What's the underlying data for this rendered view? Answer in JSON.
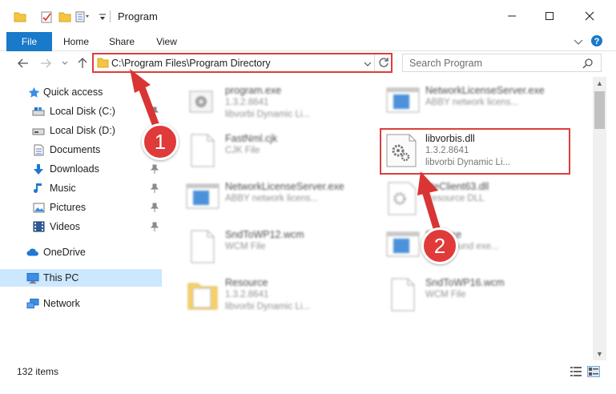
{
  "window": {
    "title": "Program"
  },
  "ribbon": {
    "tabs": [
      {
        "label": "File"
      },
      {
        "label": "Home"
      },
      {
        "label": "Share"
      },
      {
        "label": "View"
      }
    ]
  },
  "address": {
    "path": "C:\\Program Files\\Program Directory"
  },
  "search": {
    "placeholder": "Search Program"
  },
  "sidebar": {
    "items": [
      {
        "label": "Quick access",
        "icon": "star-icon"
      },
      {
        "label": "Local Disk (C:)",
        "icon": "drive-icon"
      },
      {
        "label": "Local Disk (D:)",
        "icon": "drive-icon"
      },
      {
        "label": "Documents",
        "icon": "documents-icon"
      },
      {
        "label": "Downloads",
        "icon": "download-icon"
      },
      {
        "label": "Music",
        "icon": "music-icon"
      },
      {
        "label": "Pictures",
        "icon": "pictures-icon"
      },
      {
        "label": "Videos",
        "icon": "videos-icon"
      },
      {
        "label": "OneDrive",
        "icon": "cloud-icon"
      },
      {
        "label": "This PC",
        "icon": "computer-icon"
      },
      {
        "label": "Network",
        "icon": "network-icon"
      }
    ]
  },
  "files": [
    {
      "name": "program.exe",
      "line1": "1.3.2.8641",
      "line2": "libvorbi Dynamic Li..."
    },
    {
      "name": "NetworkLicenseServer.exe",
      "line1": "ABBY network licens...",
      "line2": ""
    },
    {
      "name": "FastNml.cjk",
      "line1": "CJK File",
      "line2": ""
    },
    {
      "name": "libvorbis.dll",
      "line1": "1.3.2.8641",
      "line2": "libvorbi Dynamic Li..."
    },
    {
      "name": "NetworkLicenseServer.exe",
      "line1": "ABBY network licens...",
      "line2": ""
    },
    {
      "name": "ateClient63.dll",
      "line1": "Resource DLL",
      "line2": ""
    },
    {
      "name": "SndToWP12.wcm",
      "line1": "WCM File",
      "line2": ""
    },
    {
      "name": "Sec.exe",
      "line1": "background exe...",
      "line2": ""
    },
    {
      "name": "Resource",
      "line1": "1.3.2.8641",
      "line2": "libvorbi Dynamic Li..."
    },
    {
      "name": "SndToWP16.wcm",
      "line1": "WCM File",
      "line2": ""
    }
  ],
  "status": {
    "item_count": "132 items"
  },
  "annotations": {
    "badge1": "1",
    "badge2": "2",
    "color": "#e03a3a"
  },
  "colors": {
    "accent": "#1979ca",
    "selection": "#cce8ff",
    "highlight": "#de3d3d"
  }
}
